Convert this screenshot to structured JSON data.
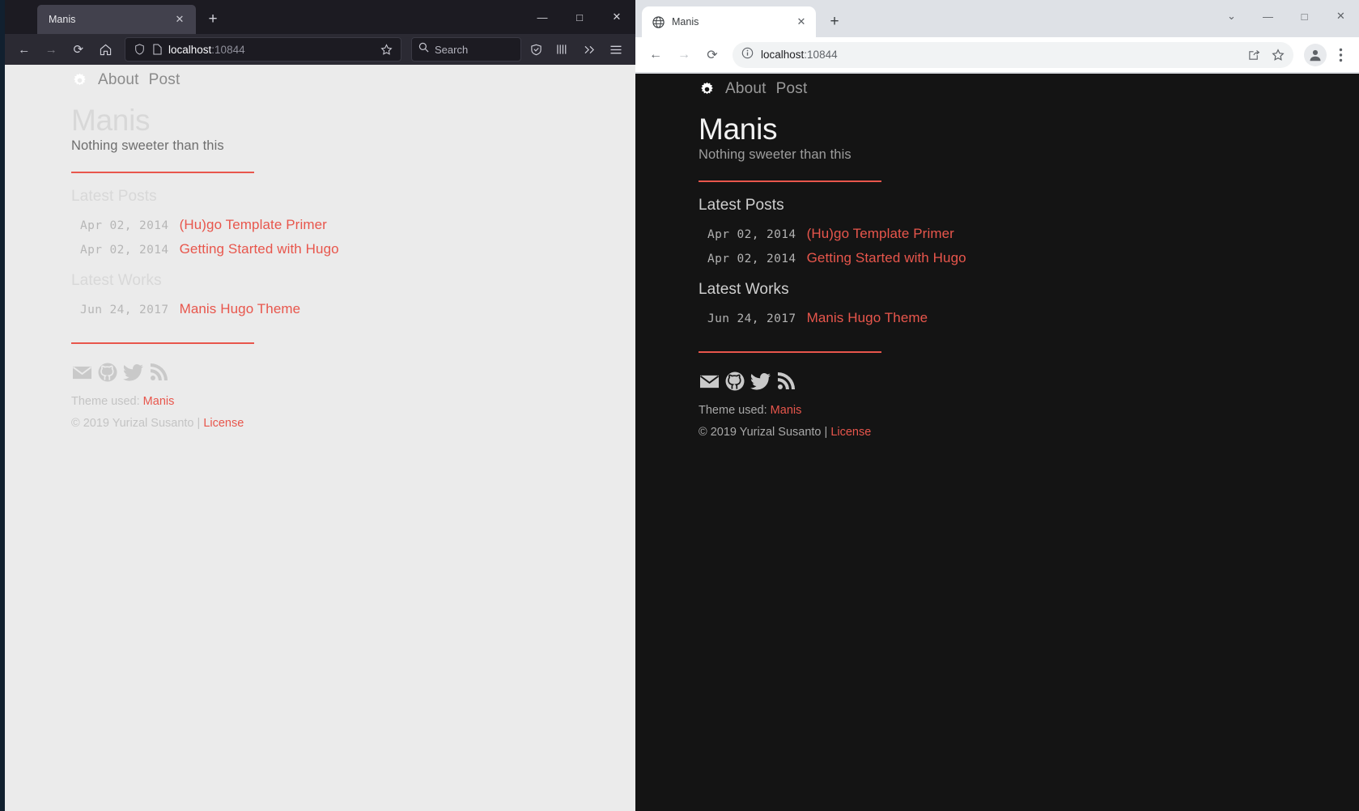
{
  "accent_color": "#e8564c",
  "firefox": {
    "tab": {
      "title": "Manis",
      "close_label": "✕"
    },
    "new_tab_label": "+",
    "window_controls": {
      "minimize": "—",
      "maximize": "□",
      "close": "✕"
    },
    "nav": {
      "back": "←",
      "forward": "→",
      "reload": "⟳",
      "home": "⌂"
    },
    "url": {
      "host": "localhost",
      "port": ":10844"
    },
    "search": {
      "placeholder": "Search"
    },
    "toolbar_icons": [
      "shield-icon",
      "library-icon",
      "overflow-icon",
      "hamburger-icon"
    ],
    "background": "#ebebeb"
  },
  "chrome": {
    "tab": {
      "title": "Manis",
      "close_label": "✕"
    },
    "new_tab_label": "+",
    "window_controls": {
      "tab_search": "⌄",
      "minimize": "—",
      "maximize": "□",
      "close": "✕"
    },
    "nav": {
      "back": "←",
      "forward": "→",
      "reload": "⟳"
    },
    "url": {
      "host": "localhost",
      "port": ":10844"
    },
    "toolbar_icons": [
      "share-icon",
      "bookmark-star-icon",
      "profile-avatar",
      "three-dot-menu-icon"
    ],
    "background": "#141414"
  },
  "page": {
    "nav": {
      "gear": "gear-icon",
      "links": [
        "About",
        "Post"
      ]
    },
    "site_title": "Manis",
    "site_subtitle": "Nothing sweeter than this",
    "sections": [
      {
        "heading": "Latest Posts",
        "entries": [
          {
            "date": "Apr 02, 2014",
            "title": "(Hu)go Template Primer"
          },
          {
            "date": "Apr 02, 2014",
            "title": "Getting Started with Hugo"
          }
        ]
      },
      {
        "heading": "Latest Works",
        "entries": [
          {
            "date": "Jun 24, 2017",
            "title": "Manis Hugo Theme"
          }
        ]
      }
    ],
    "socials": [
      "email-icon",
      "github-icon",
      "twitter-icon",
      "rss-icon"
    ],
    "footer": {
      "theme_prefix": "Theme used: ",
      "theme_name": "Manis",
      "copyright": "© 2019 Yurizal Susanto | ",
      "license": "License"
    }
  }
}
